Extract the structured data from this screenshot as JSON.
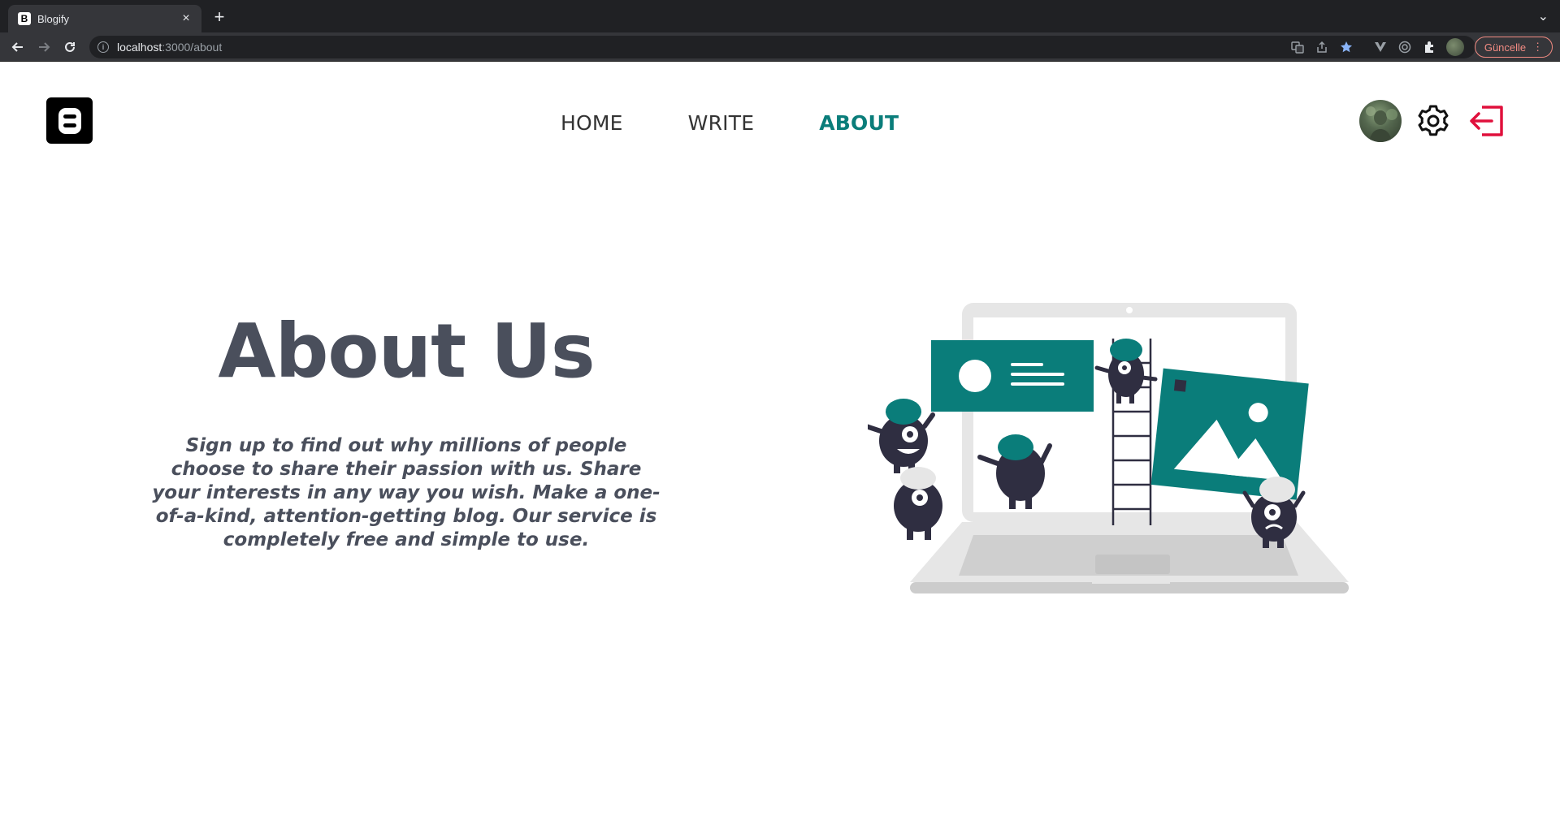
{
  "browser": {
    "tab_title": "Blogify",
    "tab_favicon_letter": "B",
    "url_host": "localhost",
    "url_path": ":3000/about",
    "update_label": "Güncelle"
  },
  "nav": {
    "items": [
      {
        "label": "HOME",
        "active": false
      },
      {
        "label": "WRITE",
        "active": false
      },
      {
        "label": "ABOUT",
        "active": true
      }
    ]
  },
  "hero": {
    "title": "About Us",
    "text": "Sign up to find out why millions of people choose to share their passion with us. Share your interests in any way you wish. Make a one-of-a-kind, attention-getting blog. Our service is completely free and simple to use."
  },
  "colors": {
    "accent": "#0a7d7a",
    "logout": "#e0103c",
    "heading": "#4a4f5c"
  },
  "icons": {
    "logo": "blogger-logo-icon",
    "settings": "gear-icon",
    "logout": "logout-icon"
  }
}
